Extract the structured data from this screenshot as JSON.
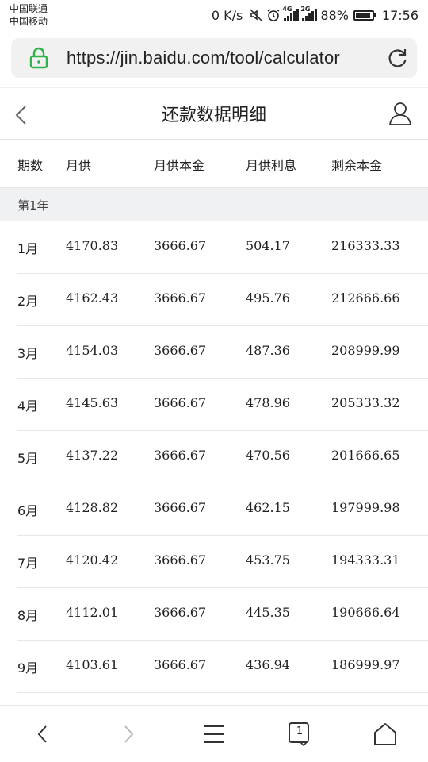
{
  "status_bar": {
    "carrier_1": "中国联通",
    "carrier_2": "中国移动",
    "net_speed": "0 K/s",
    "sig1_tag": "4G",
    "sig2_tag": "2G",
    "battery_text": "88%",
    "battery_level": 0.88,
    "time": "17:56"
  },
  "browser": {
    "url": "https://jin.baidu.com/tool/calculator",
    "icons": {
      "lock": "lock-icon",
      "refresh": "refresh-icon"
    },
    "accent_color": "#2db34a"
  },
  "header": {
    "title": "还款数据明细",
    "icons": {
      "back": "chevron-left-icon",
      "user": "user-icon"
    }
  },
  "table": {
    "columns": [
      "期数",
      "月供",
      "月供本金",
      "月供利息",
      "剩余本金"
    ],
    "section_label": "第1年",
    "rows": [
      {
        "period": "1月",
        "payment": "4170.83",
        "principal": "3666.67",
        "interest": "504.17",
        "remaining": "216333.33"
      },
      {
        "period": "2月",
        "payment": "4162.43",
        "principal": "3666.67",
        "interest": "495.76",
        "remaining": "212666.66"
      },
      {
        "period": "3月",
        "payment": "4154.03",
        "principal": "3666.67",
        "interest": "487.36",
        "remaining": "208999.99"
      },
      {
        "period": "4月",
        "payment": "4145.63",
        "principal": "3666.67",
        "interest": "478.96",
        "remaining": "205333.32"
      },
      {
        "period": "5月",
        "payment": "4137.22",
        "principal": "3666.67",
        "interest": "470.56",
        "remaining": "201666.65"
      },
      {
        "period": "6月",
        "payment": "4128.82",
        "principal": "3666.67",
        "interest": "462.15",
        "remaining": "197999.98"
      },
      {
        "period": "7月",
        "payment": "4120.42",
        "principal": "3666.67",
        "interest": "453.75",
        "remaining": "194333.31"
      },
      {
        "period": "8月",
        "payment": "4112.01",
        "principal": "3666.67",
        "interest": "445.35",
        "remaining": "190666.64"
      },
      {
        "period": "9月",
        "payment": "4103.61",
        "principal": "3666.67",
        "interest": "436.94",
        "remaining": "186999.97"
      }
    ]
  },
  "bottom_nav": {
    "tab_count": "1",
    "icons": [
      "chevron-left-icon",
      "chevron-right-icon",
      "menu-icon",
      "tabs-icon",
      "home-icon"
    ]
  }
}
